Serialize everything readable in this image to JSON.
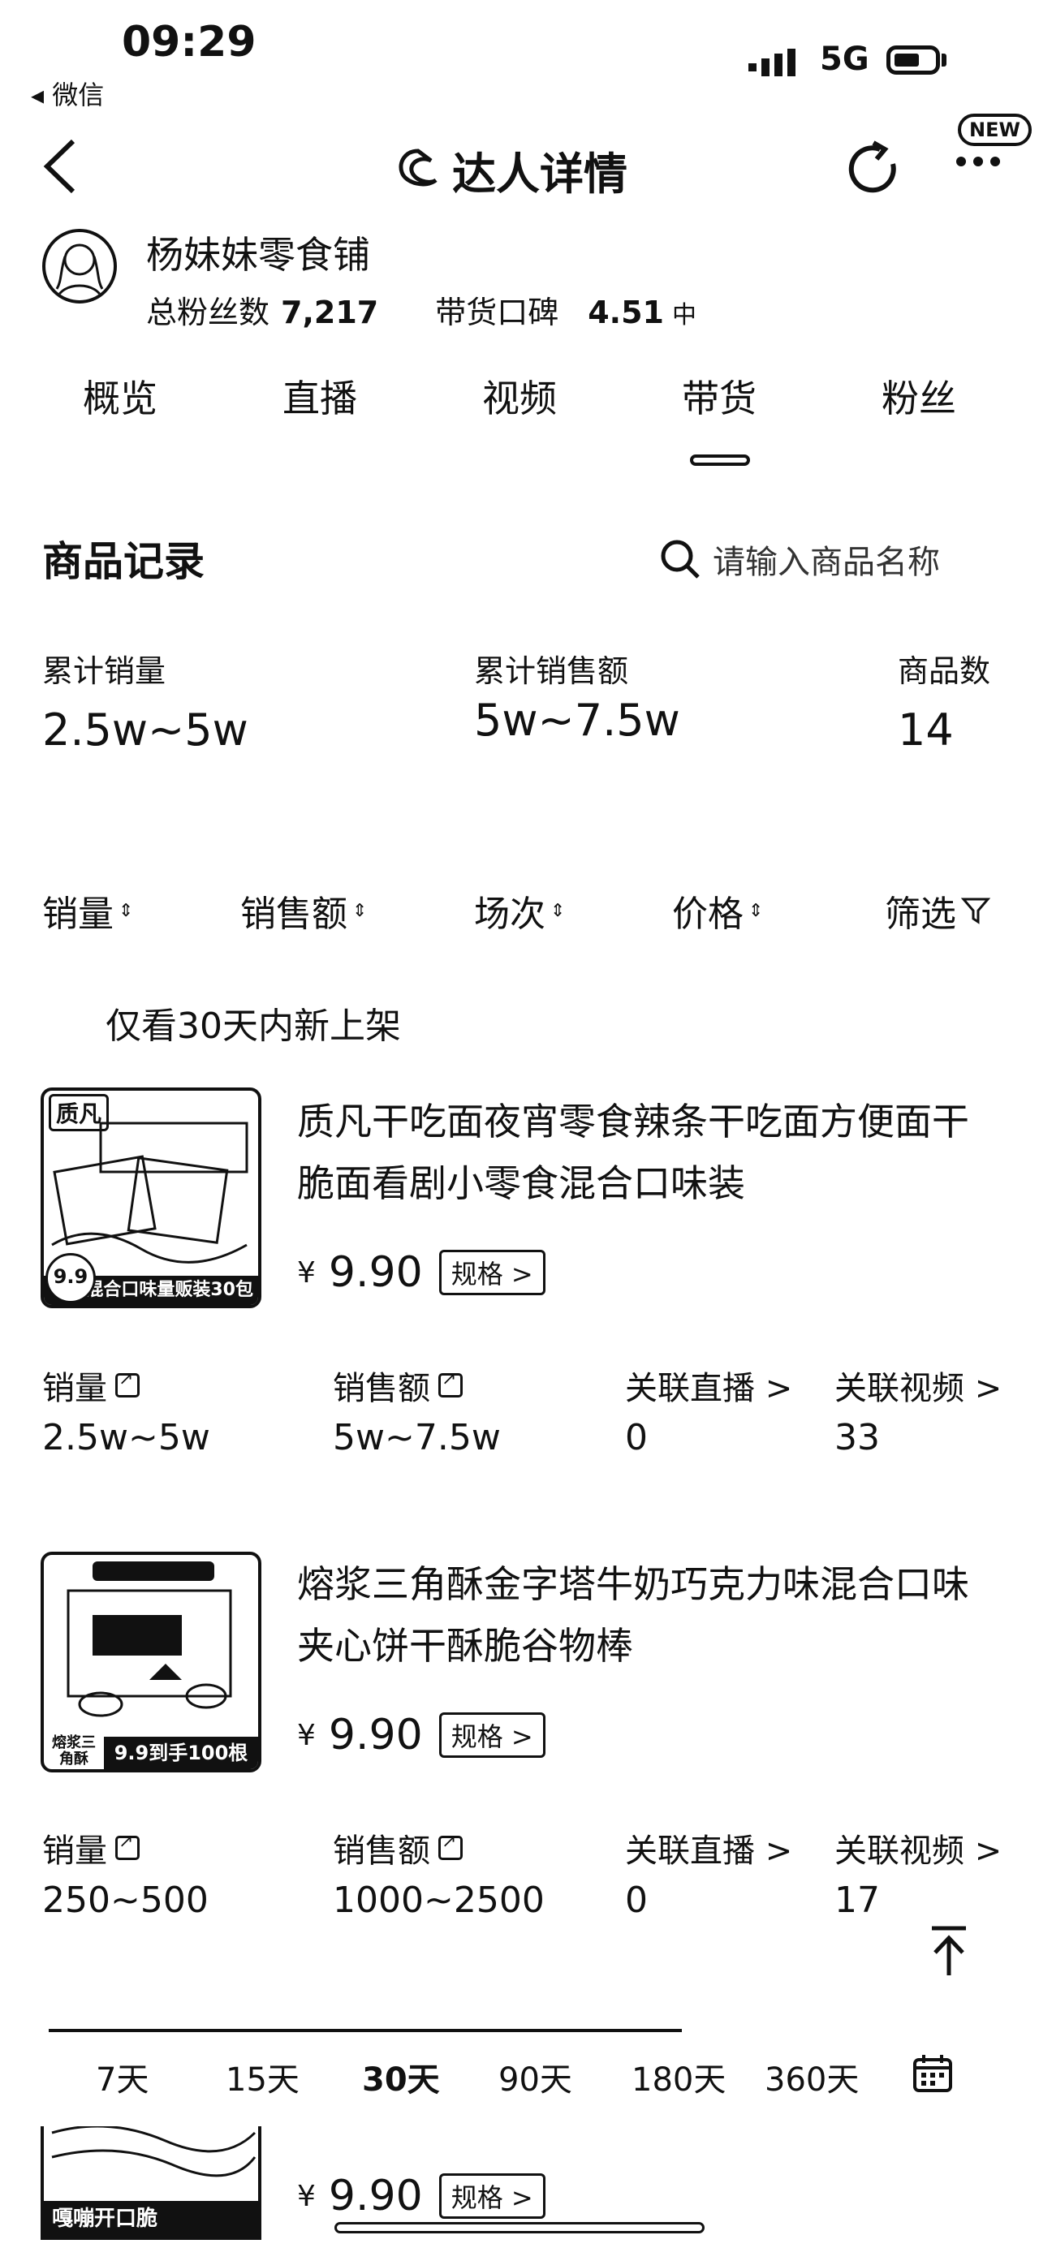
{
  "status_bar": {
    "time": "09:29",
    "back_app": "◂ 微信",
    "network": "5G"
  },
  "nav": {
    "title": "达人详情",
    "new_badge": "NEW"
  },
  "profile": {
    "name": "杨妹妹零食铺",
    "fans_label": "总粉丝数",
    "fans_value": "7,217",
    "rep_label": "带货口碑",
    "rep_value": "4.51",
    "rep_level": "中"
  },
  "tabs": [
    "概览",
    "直播",
    "视频",
    "带货",
    "粉丝"
  ],
  "active_tab": "带货",
  "section": {
    "title": "商品记录",
    "search_placeholder": "请输入商品名称"
  },
  "summary": {
    "sales_label": "累计销量",
    "sales_value": "2.5w~5w",
    "revenue_label": "累计销售额",
    "revenue_value": "5w~7.5w",
    "count_label": "商品数",
    "count_value": "14"
  },
  "sort_bar": {
    "sales": "销量",
    "revenue": "销售额",
    "sessions": "场次",
    "price": "价格",
    "filter": "筛选"
  },
  "only_new_label": "仅看30天内新上架",
  "metric_labels": {
    "sales": "销量",
    "revenue": "销售额",
    "live": "关联直播 >",
    "video": "关联视频 >"
  },
  "products": [
    {
      "title": "质凡干吃面夜宵零食辣条干吃面方便面干脆面看剧小零食混合口味装",
      "yen": "¥",
      "price": "9.90",
      "spec": "规格 >",
      "thumb_brand": "质凡",
      "thumb_tag": "9.9",
      "thumb_banner": "混合口味量贩装30包",
      "sales": "2.5w~5w",
      "revenue": "5w~7.5w",
      "live": "0",
      "video": "33"
    },
    {
      "title": "熔浆三角酥金字塔牛奶巧克力味混合口味夹心饼干酥脆谷物棒",
      "yen": "¥",
      "price": "9.90",
      "spec": "规格 >",
      "thumb_brand": "熔浆三角酥",
      "thumb_tag": "熔浆三角酥",
      "thumb_banner": "9.9到手100根",
      "sales": "250~500",
      "revenue": "1000~2500",
      "live": "0",
      "video": "17"
    },
    {
      "title": "",
      "yen": "¥",
      "price": "9.90",
      "spec": "规格 >",
      "thumb_brand": "",
      "thumb_tag": "",
      "thumb_banner": "嘎嘣开口脆"
    }
  ],
  "days": [
    "7天",
    "15天",
    "30天",
    "90天",
    "180天",
    "360天"
  ],
  "active_day": "30天"
}
